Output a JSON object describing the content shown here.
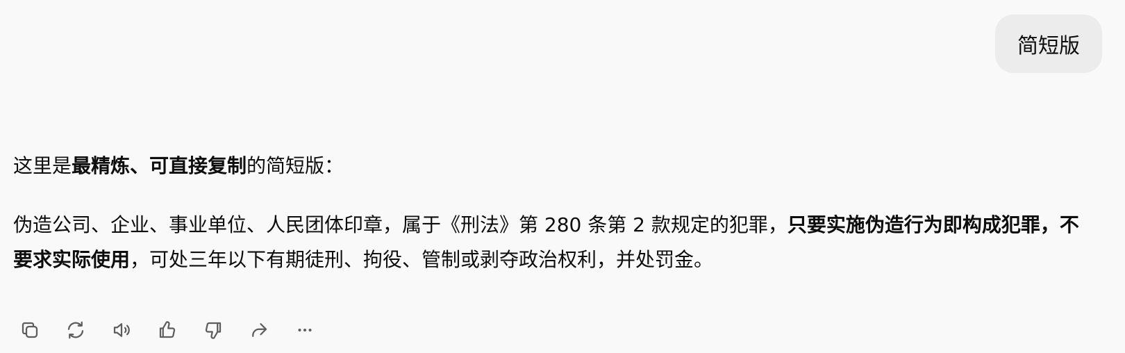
{
  "user_message": {
    "text": "简短版"
  },
  "assistant_message": {
    "intro": {
      "prefix": "这里是",
      "bold": "最精炼、可直接复制",
      "suffix": "的简短版："
    },
    "body": {
      "part1": "伪造公司、企业、事业单位、人民团体印章，属于《刑法》第 280 条第 2 款规定的犯罪，",
      "bold": "只要实施伪造行为即构成犯罪，不要求实际使用",
      "part2": "，可处三年以下有期徒刑、拘役、管制或剥夺政治权利，并处罚金。"
    }
  },
  "action_bar": {
    "icons": [
      "copy-icon",
      "regenerate-icon",
      "read-aloud-icon",
      "thumbs-up-icon",
      "thumbs-down-icon",
      "share-icon",
      "more-icon"
    ]
  }
}
